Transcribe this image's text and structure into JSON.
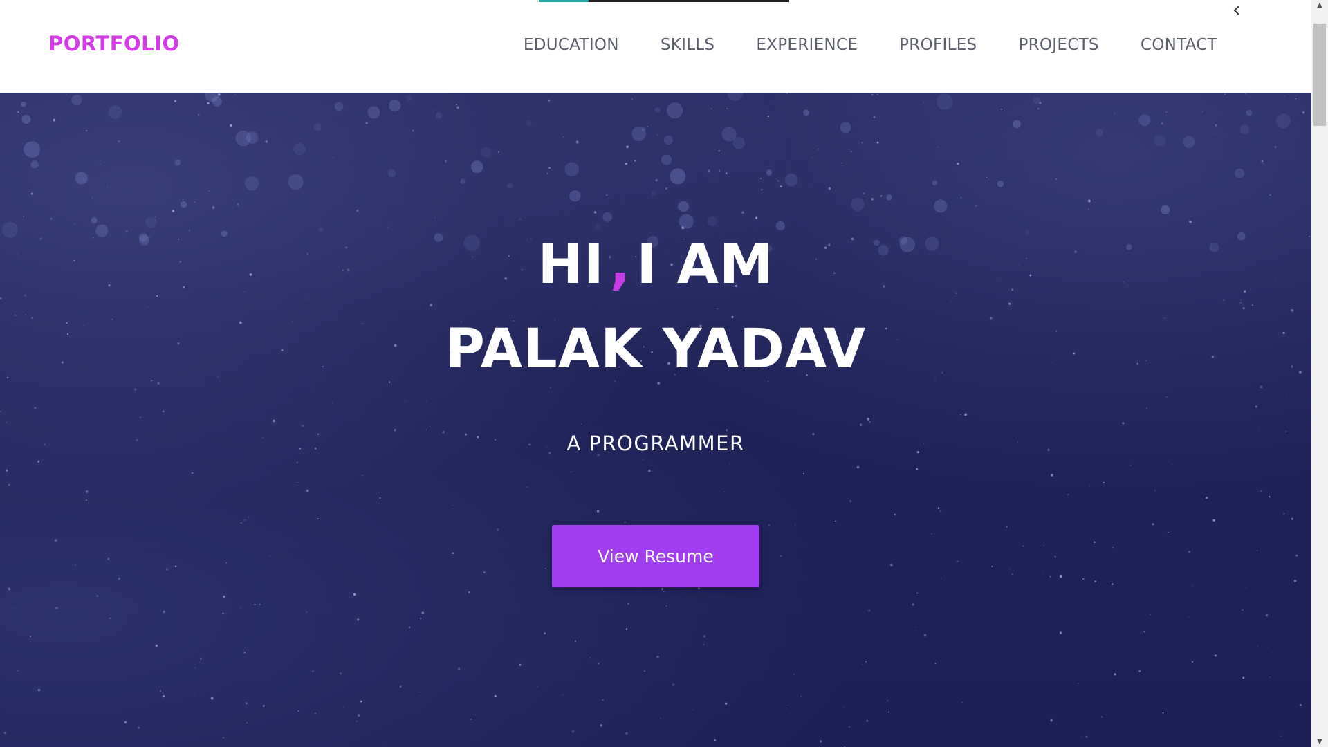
{
  "nav": {
    "brand": "PORTFOLIO",
    "links": [
      "EDUCATION",
      "SKILLS",
      "EXPERIENCE",
      "PROFILES",
      "PROJECTS",
      "CONTACT"
    ],
    "toggle_icon": "chevron-left-icon"
  },
  "hero": {
    "greeting_before": "HI",
    "greeting_comma": ",",
    "greeting_after": "I AM",
    "name": "PALAK YADAV",
    "role": "A PROGRAMMER",
    "button_label": "View Resume"
  },
  "colors": {
    "brand": "#d63ae8",
    "accent": "#c93be6",
    "button": "#a23df0",
    "hero_bg": "#1f2358",
    "nav_text": "#5b5f6b"
  }
}
